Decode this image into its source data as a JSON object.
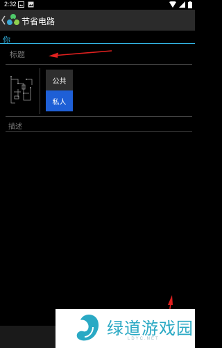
{
  "status_bar": {
    "time": "2:32"
  },
  "action_bar": {
    "title": "节省电路"
  },
  "section": {
    "label": "你"
  },
  "form": {
    "title_placeholder": "标题",
    "visibility_options": [
      "公共",
      "私人"
    ],
    "selected_visibility": "私人",
    "description_placeholder": "描述"
  },
  "watermark": {
    "brand": "绿道游戏园",
    "domain": "LDYC.NET"
  },
  "colors": {
    "accent": "#33b5e5",
    "selected_button": "#1e5fd6",
    "arrow": "#e0201f"
  }
}
